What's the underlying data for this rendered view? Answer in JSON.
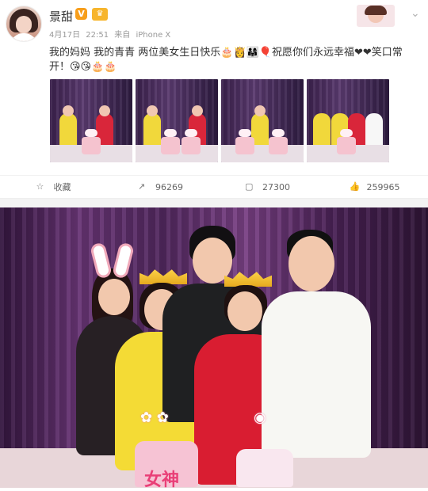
{
  "post": {
    "username": "景甜",
    "verified_badge": "V",
    "member_badge": "♛",
    "date": "4月17日",
    "time": "22:51",
    "source_label": "来自",
    "device": "iPhone X",
    "text_line_1": "我的妈妈 我的青青 两位美女生日快乐🎂👸👨‍👩‍👧🎈祝愿你们永远幸福❤❤笑口常",
    "text_line_2": "开！😘😘🎂🎂"
  },
  "toolbar": {
    "favorite_label": "收藏",
    "repost_count": "96269",
    "comment_count": "27300",
    "like_count": "259965"
  },
  "photo": {
    "cake_text": "女神"
  },
  "icons": {
    "favorite": "star-icon",
    "repost": "share-icon",
    "comment": "comment-icon",
    "like": "thumbs-up-icon",
    "menu": "chevron-down-icon"
  }
}
